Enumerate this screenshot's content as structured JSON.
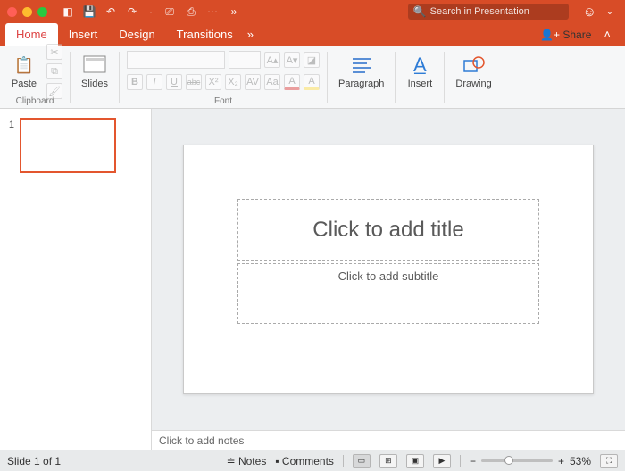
{
  "search": {
    "placeholder": "Search in Presentation"
  },
  "tabs": {
    "home": "Home",
    "insert": "Insert",
    "design": "Design",
    "transitions": "Transitions",
    "overflow": "»"
  },
  "share": "Share",
  "ribbon": {
    "clipboard": {
      "paste": "Paste",
      "label": "Clipboard"
    },
    "slides": {
      "button": "Slides"
    },
    "font": {
      "label": "Font",
      "bold": "B",
      "italic": "I",
      "underline": "U",
      "strike": "abc",
      "super": "X²",
      "sub": "X₂",
      "spacing": "AV",
      "clear": "Aa",
      "grow": "A▴",
      "shrink": "A▾",
      "eraser": "◪",
      "colorA": "A",
      "highlight": "A"
    },
    "paragraph": "Paragraph",
    "insert": "Insert",
    "drawing": "Drawing"
  },
  "thumbs": {
    "first": "1"
  },
  "slide": {
    "title_placeholder": "Click to add title",
    "subtitle_placeholder": "Click to add subtitle"
  },
  "notes_placeholder": "Click to add notes",
  "status": {
    "slide": "Slide 1 of 1",
    "notes": "Notes",
    "comments": "Comments",
    "zoom": "53%",
    "minus": "−",
    "plus": "+"
  }
}
